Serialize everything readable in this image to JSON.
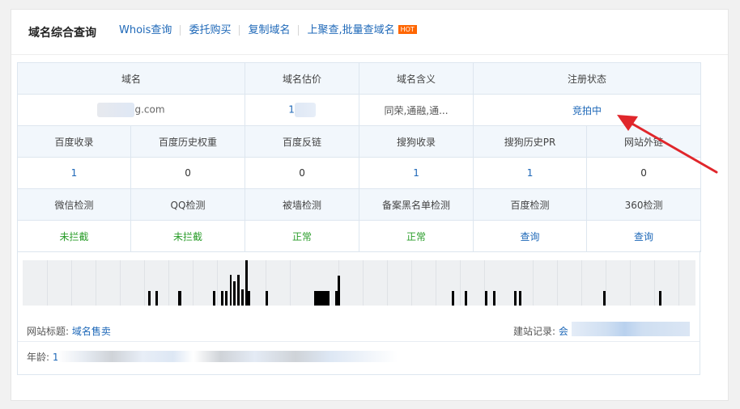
{
  "header": {
    "title": "域名综合查询",
    "links": [
      "Whois查询",
      "委托购买",
      "复制域名",
      "上聚查,批量查域名"
    ],
    "hot_badge": "HOT"
  },
  "table": {
    "row1_headers": [
      "域名",
      "域名估价",
      "域名含义",
      "注册状态"
    ],
    "row1_values": {
      "domain": "g.com",
      "estimate": "1",
      "meaning": "同荣,通融,通...",
      "status": "竞拍中"
    },
    "row2_headers": [
      "百度收录",
      "百度历史权重",
      "百度反链",
      "搜狗收录",
      "搜狗历史PR",
      "网站外链"
    ],
    "row2_values": [
      "1",
      "0",
      "0",
      "1",
      "1",
      "0"
    ],
    "row3_headers": [
      "微信检测",
      "QQ检测",
      "被墙检测",
      "备案黑名单检测",
      "百度检测",
      "360检测"
    ],
    "row3_values": [
      "未拦截",
      "未拦截",
      "正常",
      "正常",
      "查询",
      "查询"
    ]
  },
  "info": {
    "site_title_label": "网站标题:",
    "site_title_value": "域名售卖",
    "build_record_label": "建站记录:",
    "build_record_value": "会",
    "age_label": "年龄:",
    "age_value": "1"
  },
  "colors": {
    "link": "#1e68b8",
    "ok": "#2a9d2a",
    "hot": "#ff6600",
    "arrow": "#e0262b"
  }
}
